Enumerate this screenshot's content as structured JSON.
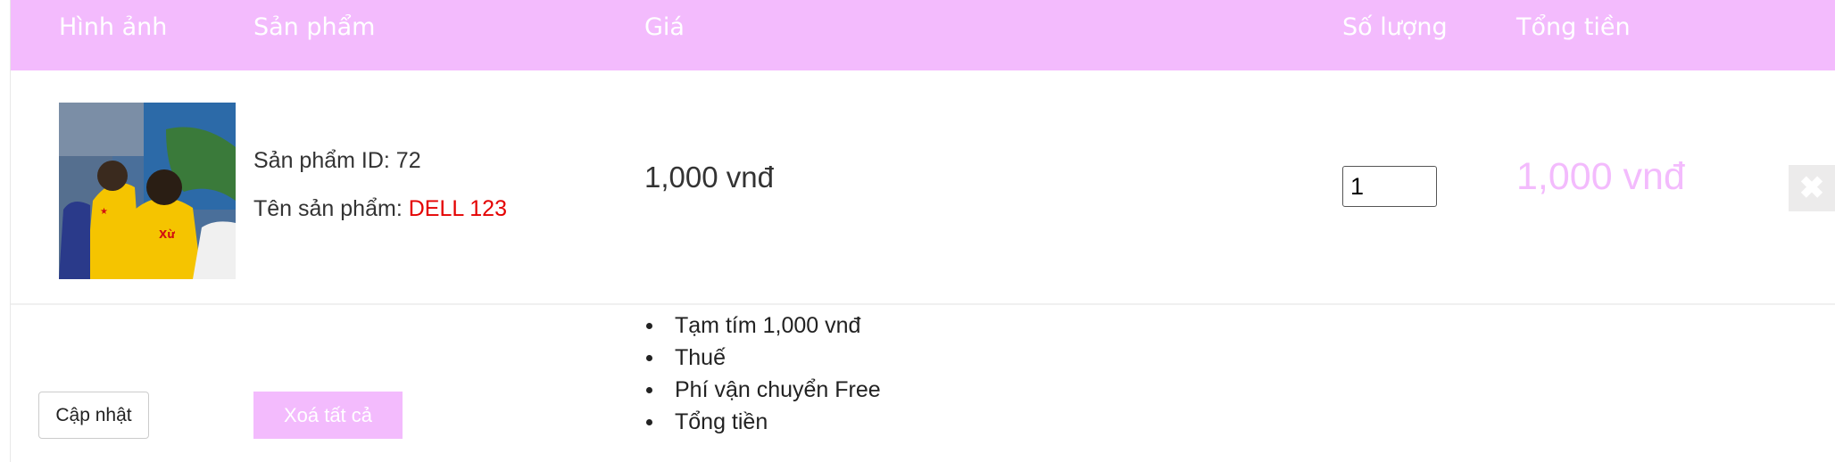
{
  "table_header": {
    "image": "Hình ảnh",
    "product": "Sản phẩm",
    "price": "Giá",
    "quantity": "Số lượng",
    "total": "Tổng tiền"
  },
  "cart_items": [
    {
      "id_label": "Sản phẩm ID: 72",
      "name_label": "Tên sản phẩm: ",
      "name_value": "DELL 123",
      "price": "1,000 vnđ",
      "quantity": "1",
      "total": "1,000 vnđ",
      "remove_icon": "close-icon"
    }
  ],
  "actions": {
    "update_label": "Cập nhật",
    "clear_all_label": "Xoá tất cả"
  },
  "summary": [
    "Tạm tím 1,000 vnđ",
    "Thuế",
    "Phí vận chuyển Free",
    "Tổng tiền"
  ],
  "colors": {
    "accent": "#f3bbfd",
    "highlight_red": "#e40000"
  }
}
